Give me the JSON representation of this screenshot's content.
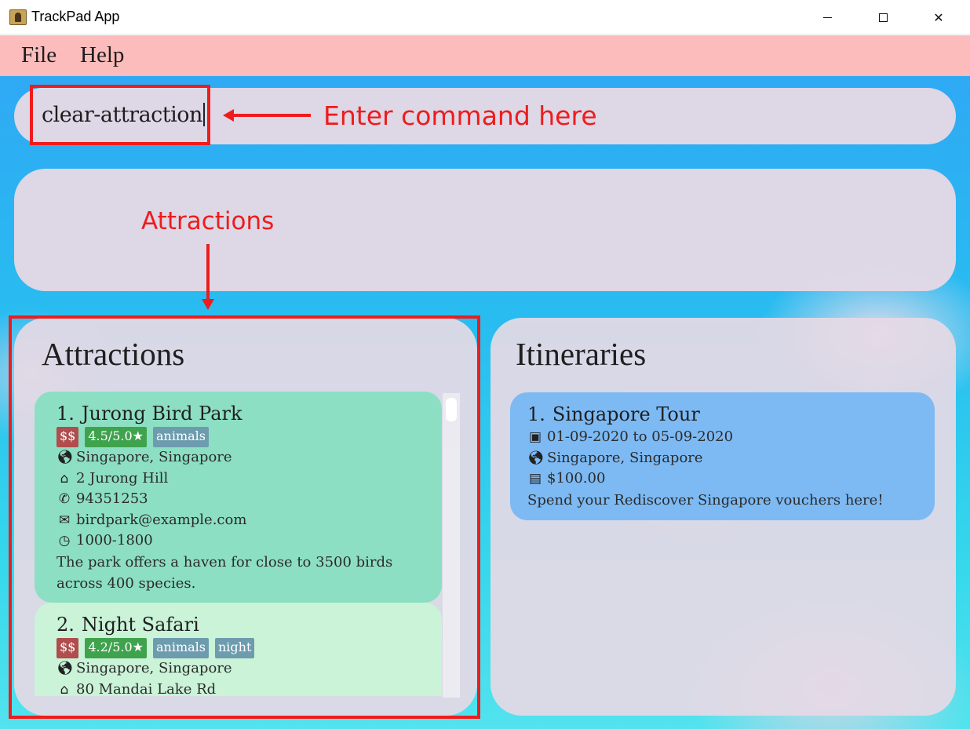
{
  "window": {
    "title": "TrackPad App",
    "close_glyph": "✕"
  },
  "menu": {
    "file": "File",
    "help": "Help"
  },
  "command": {
    "value": "clear-attraction"
  },
  "result": {
    "text": ""
  },
  "annotations": {
    "command_label": "Enter command here",
    "attractions_label": "Attractions",
    "color": "#ee1c1c"
  },
  "attractions": {
    "title": "Attractions",
    "items": [
      {
        "index": "1.",
        "name": "Jurong Bird Park",
        "price": "$$",
        "rating": "4.5/5.0★",
        "tags": [
          "animals"
        ],
        "location": "Singapore, Singapore",
        "address": "2 Jurong Hill",
        "phone": "94351253",
        "email": "birdpark@example.com",
        "hours": "1000-1800",
        "description": "The park offers a haven for close to 3500 birds across 400 species.",
        "color": "#8ddfc3"
      },
      {
        "index": "2.",
        "name": "Night Safari",
        "price": "$$",
        "rating": "4.2/5.0★",
        "tags": [
          "animals",
          "night"
        ],
        "location": "Singapore, Singapore",
        "address": "80 Mandai Lake Rd",
        "color": "#caf3d8"
      }
    ]
  },
  "itineraries": {
    "title": "Itineraries",
    "items": [
      {
        "index": "1.",
        "name": "Singapore Tour",
        "dates": "01-09-2020 to 05-09-2020",
        "location": "Singapore, Singapore",
        "budget": "$100.00",
        "description": "Spend your Rediscover Singapore vouchers here!",
        "color": "#7dbaf4"
      }
    ]
  },
  "icons": {
    "globe": "globe-icon",
    "home": "home-icon",
    "phone": "phone-icon",
    "email": "email-icon",
    "clock": "clock-icon",
    "calendar": "calendar-icon",
    "money": "money-icon"
  },
  "colors": {
    "menubar": "#fdbcbc",
    "tag_price": "#b04d4d",
    "tag_rating": "#3fa34d",
    "tag_category": "#6d9cae"
  }
}
